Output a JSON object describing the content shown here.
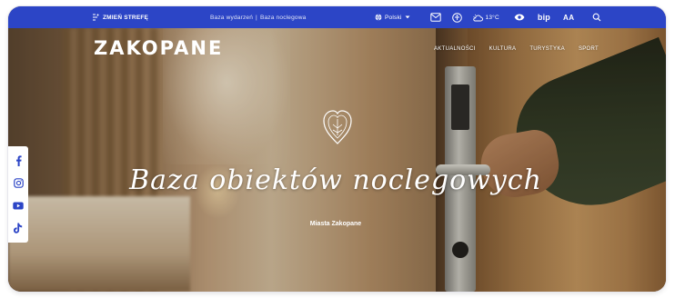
{
  "topbar": {
    "zone_label": "ZMIEŃ STREFĘ",
    "links": [
      "Baza wydarzeń",
      "|",
      "Baza noclegowa"
    ],
    "language": "Polski",
    "temperature": "13°C",
    "bip_label": "bip",
    "font_size_label": "AA",
    "accent_color": "#2c45c6"
  },
  "header": {
    "logo": "ZAKOPANE",
    "nav": [
      "AKTUALNOŚCI",
      "KULTURA",
      "TURYSTYKA",
      "SPORT"
    ]
  },
  "hero": {
    "title": "Baza obiektów noclegowych",
    "subtitle": "Miasta Zakopane"
  },
  "social": [
    "facebook-icon",
    "instagram-icon",
    "youtube-icon",
    "tiktok-icon"
  ]
}
